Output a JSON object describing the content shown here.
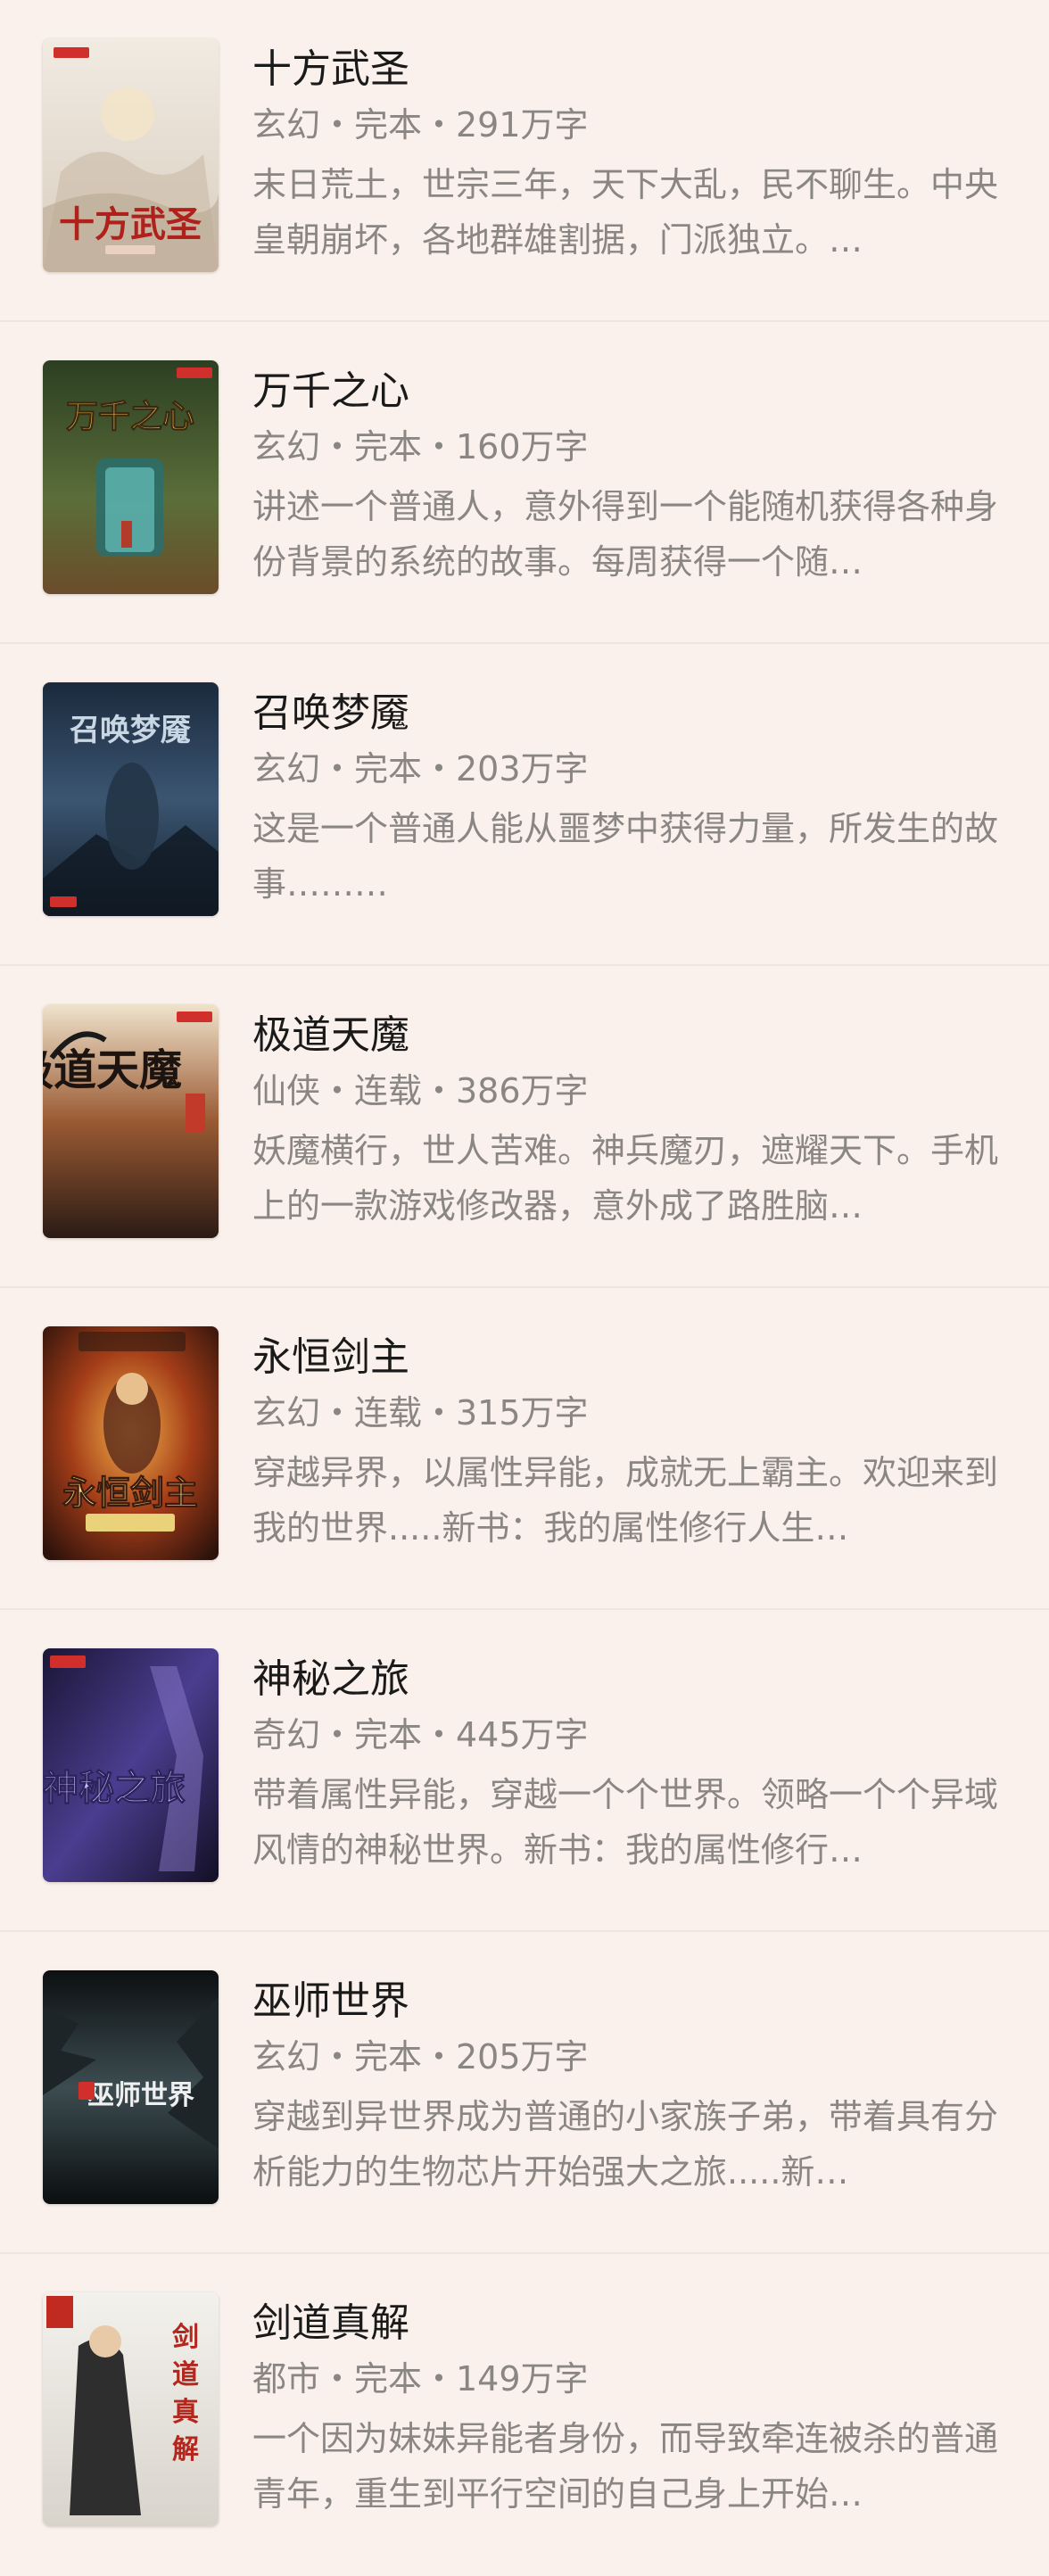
{
  "books": [
    {
      "title": "十方武圣",
      "meta": "玄幻・完本・291万字",
      "desc": "末日荒土，世宗三年，天下大乱，民不聊生。中央皇朝崩坏，各地群雄割据，门派独立。…",
      "cover_text": "十方武圣",
      "cover_colors": [
        "#efe6dc",
        "#c8b8a6",
        "#b0211c"
      ]
    },
    {
      "title": "万千之心",
      "meta": "玄幻・完本・160万字",
      "desc": "讲述一个普通人，意外得到一个能随机获得各种身份背景的系统的故事。每周获得一个随…",
      "cover_text": "万千之心",
      "cover_colors": [
        "#2f4a2c",
        "#7a5b2f",
        "#d7a640"
      ]
    },
    {
      "title": "召唤梦魇",
      "meta": "玄幻・完本・203万字",
      "desc": "这是一个普通人能从噩梦中获得力量，所发生的故事………",
      "cover_text": "召唤梦魇",
      "cover_colors": [
        "#1a2638",
        "#3d5672",
        "#c7d5e4"
      ]
    },
    {
      "title": "极道天魔",
      "meta": "仙侠・连载・386万字",
      "desc": "妖魔横行，世人苦难。神兵魔刃，遮耀天下。手机上的一款游戏修改器，意外成了路胜脑…",
      "cover_text": "极道天魔",
      "cover_colors": [
        "#2b1b14",
        "#7a4226",
        "#e8d6b8"
      ]
    },
    {
      "title": "永恒剑主",
      "meta": "玄幻・连载・315万字",
      "desc": "穿越异界，以属性异能，成就无上霸主。欢迎来到我的世界.....新书：我的属性修行人生…",
      "cover_text": "永恒剑主",
      "cover_colors": [
        "#3a1810",
        "#b2461c",
        "#f2d27a"
      ]
    },
    {
      "title": "神秘之旅",
      "meta": "奇幻・完本・445万字",
      "desc": "带着属性异能，穿越一个个世界。领略一个个异域风情的神秘世界。新书：我的属性修行…",
      "cover_text": "神秘之旅",
      "cover_colors": [
        "#1a1636",
        "#4a3a8a",
        "#c9b8f0"
      ]
    },
    {
      "title": "巫师世界",
      "meta": "玄幻・完本・205万字",
      "desc": "穿越到异世界成为普通的小家族子弟，带着具有分析能力的生物芯片开始强大之旅.....新…",
      "cover_text": "巫师世界",
      "cover_colors": [
        "#0f1416",
        "#3a4a4c",
        "#e6e6e6"
      ]
    },
    {
      "title": "剑道真解",
      "meta": "都市・完本・149万字",
      "desc": "一个因为妹妹异能者身份，而导致牵连被杀的普通青年，重生到平行空间的自己身上开始…",
      "cover_text": "剑道真解",
      "cover_colors": [
        "#e9e6df",
        "#3b3b3b",
        "#b2281e"
      ]
    }
  ]
}
